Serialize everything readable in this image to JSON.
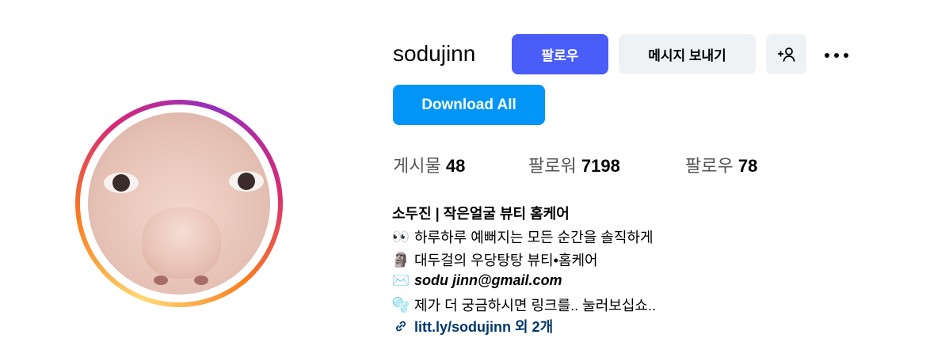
{
  "profile": {
    "username": "sodujinn"
  },
  "actions": {
    "follow_label": "팔로우",
    "message_label": "메시지 보내기",
    "download_label": "Download All"
  },
  "stats": {
    "posts_label": "게시물",
    "posts_value": "48",
    "followers_label": "팔로워",
    "followers_value": "7198",
    "following_label": "팔로우",
    "following_value": "78"
  },
  "bio": {
    "name": "소두진 | 작은얼굴 뷰티 홈케어",
    "line1_emoji": "👀",
    "line1": "하루하루 예뻐지는 모든 순간을 솔직하게",
    "line2_emoji": "🗿",
    "line2": "대두걸의 우당탕탕 뷰티•홈케어",
    "line3_emoji": "✉️",
    "email": "sodu jinn@gmail.com",
    "line4_emoji": "🫧",
    "line4": "제가 더 궁금하시면 링크를.. 눌러보십쇼..",
    "link_text": "litt.ly/sodujinn 외 2개"
  },
  "colors": {
    "follow_button": "#4a5df9",
    "download_button": "#0095f6",
    "secondary_button": "#eff2f5",
    "link": "#00376b"
  },
  "icons": [
    "add-user-icon",
    "more-options-icon",
    "link-icon"
  ]
}
